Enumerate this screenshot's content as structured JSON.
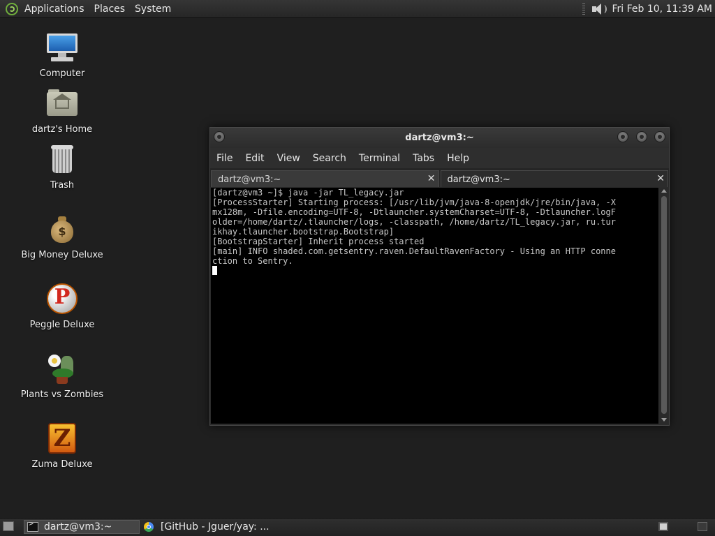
{
  "top_panel": {
    "menus": [
      "Applications",
      "Places",
      "System"
    ],
    "clock": "Fri Feb 10, 11:39 AM"
  },
  "desktop": {
    "icons": [
      {
        "label": "Computer",
        "icon": "computer-icon"
      },
      {
        "label": "dartz's Home",
        "icon": "home-folder-icon"
      },
      {
        "label": "Trash",
        "icon": "trash-icon"
      },
      {
        "label": "Big Money Deluxe",
        "icon": "money-bag-icon"
      },
      {
        "label": "Peggle Deluxe",
        "icon": "peggle-icon"
      },
      {
        "label": "Plants vs Zombies",
        "icon": "plants-vs-zombies-icon"
      },
      {
        "label": "Zuma Deluxe",
        "icon": "zuma-icon"
      }
    ]
  },
  "terminal_window": {
    "title": "dartz@vm3:~",
    "menu": [
      "File",
      "Edit",
      "View",
      "Search",
      "Terminal",
      "Tabs",
      "Help"
    ],
    "tabs": [
      {
        "label": "dartz@vm3:~",
        "active": false
      },
      {
        "label": "dartz@vm3:~",
        "active": true
      }
    ],
    "close_glyph": "✕",
    "output": "[dartz@vm3 ~]$ java -jar TL_legacy.jar\n[ProcessStarter] Starting process: [/usr/lib/jvm/java-8-openjdk/jre/bin/java, -X\nmx128m, -Dfile.encoding=UTF-8, -Dtlauncher.systemCharset=UTF-8, -Dtlauncher.logF\nolder=/home/dartz/.tlauncher/logs, -classpath, /home/dartz/TL_legacy.jar, ru.tur\nikhay.tlauncher.bootstrap.Bootstrap]\n[BootstrapStarter] Inherit process started\n[main] INFO shaded.com.getsentry.raven.DefaultRavenFactory - Using an HTTP conne\nction to Sentry.\n"
  },
  "taskbar": {
    "tasks": [
      {
        "label": "dartz@vm3:~",
        "icon": "terminal-icon",
        "active": true
      },
      {
        "label": "[GitHub - Jguer/yay: ...",
        "icon": "chrome-icon",
        "active": false
      }
    ]
  }
}
